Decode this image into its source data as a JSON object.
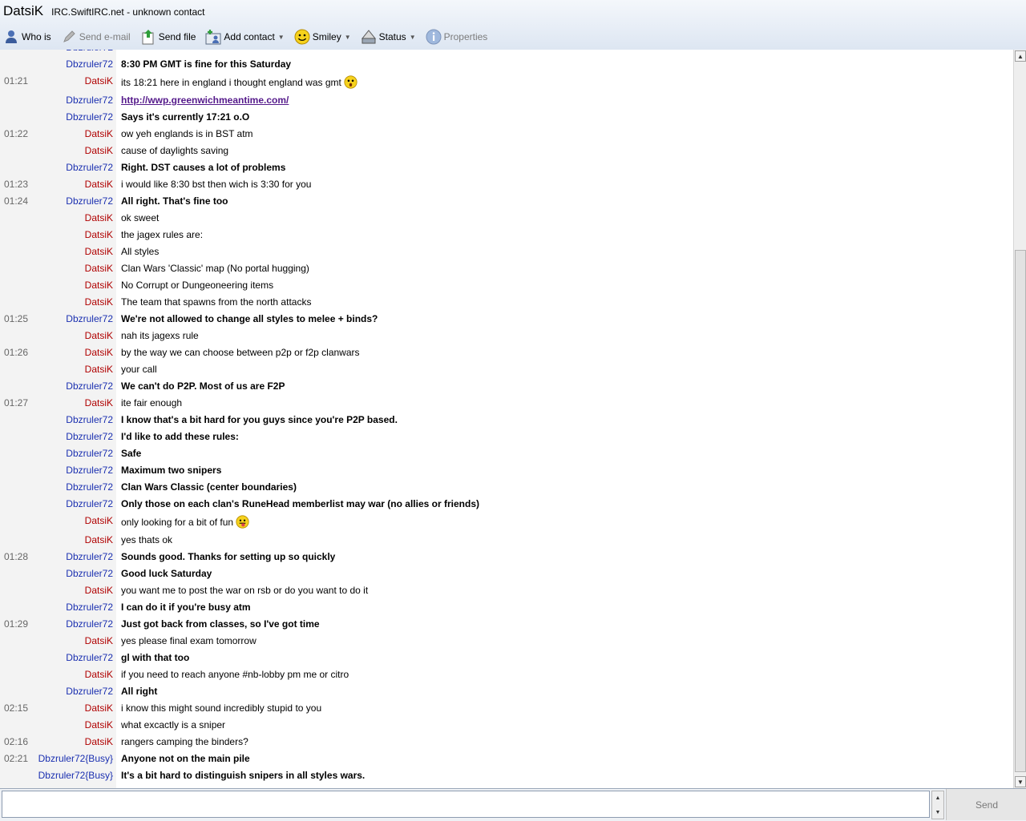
{
  "window": {
    "title": "DatsiK",
    "subtitle": "IRC.SwiftIRC.net - unknown contact"
  },
  "toolbar": {
    "whois": "Who is",
    "email": "Send e-mail",
    "sendfile": "Send file",
    "addcontact": "Add contact",
    "smiley": "Smiley",
    "status": "Status",
    "properties": "Properties"
  },
  "messages": [
    {
      "time": "",
      "nick": "Dbzruler72",
      "text": "8:30 PM GMT is fine for this Saturday",
      "style": "bold"
    },
    {
      "time": "01:21",
      "nick": "DatsiK",
      "text": "its 18:21 here in england i thought england was gmt",
      "emoji": "surprised"
    },
    {
      "time": "",
      "nick": "Dbzruler72",
      "text": "http://wwp.greenwichmeantime.com/",
      "style": "link"
    },
    {
      "time": "",
      "nick": "Dbzruler72",
      "text": "Says it's currently 17:21 o.O",
      "style": "bold"
    },
    {
      "time": "01:22",
      "nick": "DatsiK",
      "text": "ow yeh englands is in BST atm"
    },
    {
      "time": "",
      "nick": "DatsiK",
      "text": "cause of daylights saving"
    },
    {
      "time": "",
      "nick": "Dbzruler72",
      "text": "Right. DST causes a lot of problems",
      "style": "bold"
    },
    {
      "time": "01:23",
      "nick": "DatsiK",
      "text": "i would like 8:30 bst then wich is 3:30 for you"
    },
    {
      "time": "01:24",
      "nick": "Dbzruler72",
      "text": "All right. That's fine too",
      "style": "bold"
    },
    {
      "time": "",
      "nick": "DatsiK",
      "text": "ok sweet"
    },
    {
      "time": "",
      "nick": "DatsiK",
      "text": "the jagex rules are:"
    },
    {
      "time": "",
      "nick": "DatsiK",
      "text": "All styles"
    },
    {
      "time": "",
      "nick": "DatsiK",
      "text": "Clan Wars 'Classic' map (No portal hugging)"
    },
    {
      "time": "",
      "nick": "DatsiK",
      "text": "No Corrupt or Dungeoneering items"
    },
    {
      "time": "",
      "nick": "DatsiK",
      "text": "The team that spawns from the north attacks"
    },
    {
      "time": "01:25",
      "nick": "Dbzruler72",
      "text": "We're not allowed to change all styles to melee + binds?",
      "style": "bold"
    },
    {
      "time": "",
      "nick": "DatsiK",
      "text": "nah its jagexs rule"
    },
    {
      "time": "01:26",
      "nick": "DatsiK",
      "text": "by the way we can choose between p2p or f2p clanwars"
    },
    {
      "time": "",
      "nick": "DatsiK",
      "text": "your call"
    },
    {
      "time": "",
      "nick": "Dbzruler72",
      "text": "We can't do P2P. Most of us are F2P",
      "style": "bold"
    },
    {
      "time": "01:27",
      "nick": "DatsiK",
      "text": "ite fair enough"
    },
    {
      "time": "",
      "nick": "Dbzruler72",
      "text": "I know that's a bit hard for you guys since you're P2P based.",
      "style": "bold"
    },
    {
      "time": "",
      "nick": "Dbzruler72",
      "text": "I'd like to add these rules:",
      "style": "bold"
    },
    {
      "time": "",
      "nick": "Dbzruler72",
      "text": "Safe",
      "style": "bold"
    },
    {
      "time": "",
      "nick": "Dbzruler72",
      "text": "Maximum two snipers",
      "style": "bold"
    },
    {
      "time": "",
      "nick": "Dbzruler72",
      "text": "Clan Wars Classic (center boundaries)",
      "style": "bold"
    },
    {
      "time": "",
      "nick": "Dbzruler72",
      "text": "Only those on each clan's RuneHead memberlist may war (no allies or friends)",
      "style": "bold"
    },
    {
      "time": "",
      "nick": "DatsiK",
      "text": "only looking for a bit of fun",
      "emoji": "tongue"
    },
    {
      "time": "",
      "nick": "DatsiK",
      "text": "yes thats ok"
    },
    {
      "time": "01:28",
      "nick": "Dbzruler72",
      "text": "Sounds good. Thanks for setting up so quickly",
      "style": "bold"
    },
    {
      "time": "",
      "nick": "Dbzruler72",
      "text": "Good luck Saturday",
      "style": "bold"
    },
    {
      "time": "",
      "nick": "DatsiK",
      "text": "you want me to post the war on rsb or do you want to do it"
    },
    {
      "time": "",
      "nick": "Dbzruler72",
      "text": "I can do it if you're busy atm",
      "style": "bold"
    },
    {
      "time": "01:29",
      "nick": "Dbzruler72",
      "text": "Just got back from classes, so I've got time",
      "style": "bold"
    },
    {
      "time": "",
      "nick": "DatsiK",
      "text": "yes please final exam tomorrow"
    },
    {
      "time": "",
      "nick": "Dbzruler72",
      "text": "gl with that too",
      "style": "bold"
    },
    {
      "time": "",
      "nick": "DatsiK",
      "text": "if you need to reach anyone #nb-lobby pm me or citro"
    },
    {
      "time": "",
      "nick": "Dbzruler72",
      "text": "All right",
      "style": "bold"
    },
    {
      "time": "02:15",
      "nick": "DatsiK",
      "text": "i know this might sound incredibly stupid to you"
    },
    {
      "time": "",
      "nick": "DatsiK",
      "text": "what excactly is a sniper"
    },
    {
      "time": "02:16",
      "nick": "DatsiK",
      "text": "rangers camping the binders?"
    },
    {
      "time": "02:21",
      "nick": "Dbzruler72{Busy}",
      "text": "Anyone not on the main pile",
      "style": "bold"
    },
    {
      "time": "",
      "nick": "Dbzruler72{Busy}",
      "text": "It's a bit hard to distinguish snipers in all styles wars.",
      "style": "bold"
    }
  ],
  "input": {
    "value": "",
    "send_label": "Send"
  },
  "colors": {
    "datsik_nick": "#b00000",
    "dbz_nick": "#1a2fb0",
    "link": "#551a8b"
  }
}
